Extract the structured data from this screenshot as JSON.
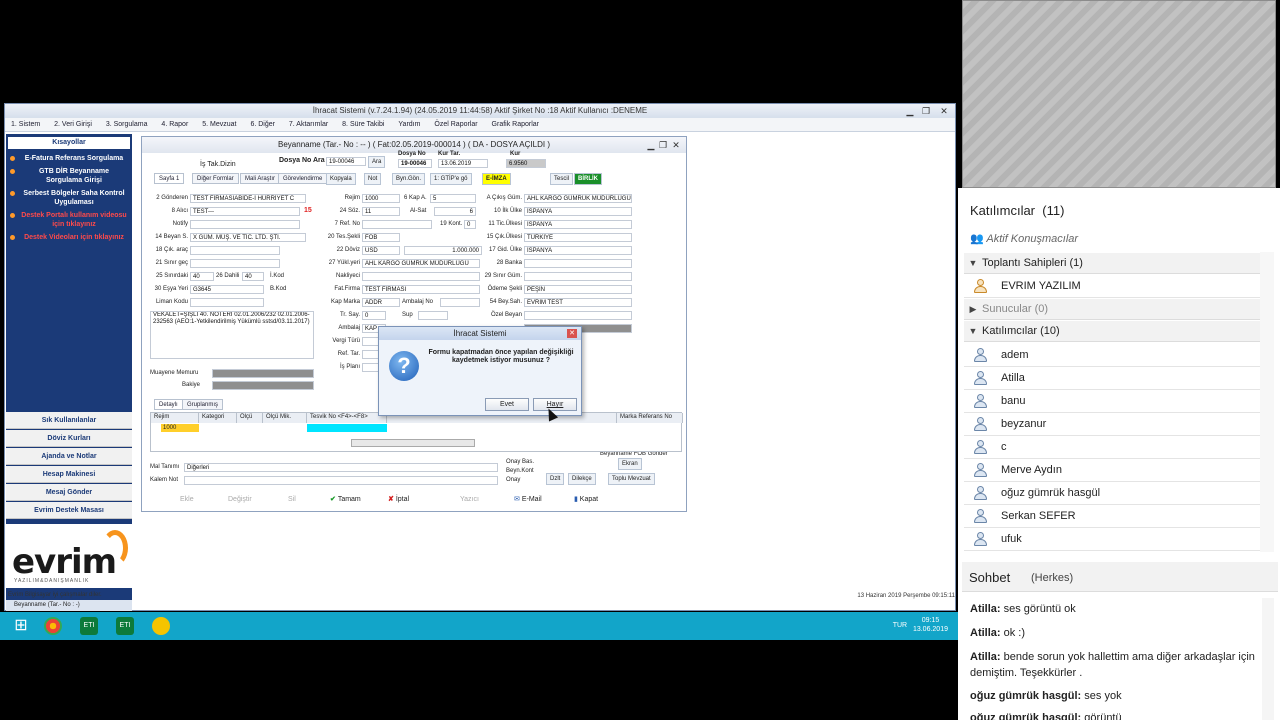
{
  "app": {
    "title": "İhracat Sistemi (v.7.24.1.94) (24.05.2019 11:44:58) Aktif Şirket No :18 Aktif Kullanıcı :DENEME",
    "menu": [
      "1. Sistem",
      "2. Veri Girişi",
      "3. Sorgulama",
      "4. Rapor",
      "5. Mevzuat",
      "6. Diğer",
      "7. Aktarımlar",
      "8. Süre Takibi",
      "Yardım",
      "Özel Raporlar",
      "Grafik Raporlar"
    ]
  },
  "sidebar": {
    "header": "Kısayollar",
    "items": [
      {
        "label": "E-Fatura Referans Sorgulama",
        "red": false
      },
      {
        "label": "GTB DİR Beyanname Sorgulama Girişi",
        "red": false
      },
      {
        "label": "Serbest Bölgeler Saha Kontrol Uygulaması",
        "red": false
      },
      {
        "label": "Destek Portalı kullanım videosu için tıklayınız",
        "red": true
      },
      {
        "label": "Destek Videoları için tıklayınız",
        "red": true
      }
    ],
    "bottom": [
      "Sık Kullanılanlar",
      "Döviz Kurları",
      "Ajanda ve Notlar",
      "Hesap Makinesi",
      "Mesaj Gönder",
      "Evrim Destek Masası"
    ],
    "logo_text": "evrim",
    "logo_sub": "YAZILIM&DANIŞMANLIK",
    "status": "Evrim Bilgisayar iyi çalışmalar diler.",
    "task": "Beyanname (Tar.- No : -)"
  },
  "form": {
    "title": "Beyanname (Tar.- No : -- ) ( Fat:02.05.2019-000014 ) ( DA - DOSYA AÇILDI )",
    "top": {
      "is_takip": "İş Tak.Dizin",
      "dosya_no_ara": "Dosya No Ara",
      "dosya_no_ara_val": "19-00046",
      "ara": "Ara",
      "dosya_no": "Dosya No",
      "dosya_no_val": "19-00046",
      "kur_tar": "Kur Tar.",
      "kur_tar_val": "13.06.2019",
      "kur": "Kur",
      "kur_val": "6.9560"
    },
    "tabs": [
      "Sayfa 1",
      "Diğer Formlar",
      "Mali Araştır",
      "Görevlendirme",
      "Kopyala",
      "Not",
      "Byn.Gön.",
      "1: GTİP'e gö",
      "E-İMZA",
      "Tescil",
      "BİRLİK"
    ],
    "left_fields": [
      {
        "label": "2 Gönderen",
        "value": "TEST FİRMASIABİDE-İ HÜRRİYET C"
      },
      {
        "label": "8 Alıcı",
        "value": "TEST---"
      },
      {
        "label": "Notify",
        "value": ""
      },
      {
        "label": "14 Beyan S.",
        "value": "X GÜM. MÜŞ. VE TİC. LTD. ŞTİ."
      },
      {
        "label": "18 Çık. araç",
        "value": ""
      },
      {
        "label": "21 Sınır geç",
        "value": ""
      },
      {
        "label": "25 Sınırdaki",
        "value": "40"
      },
      {
        "label": "30 Eşya Yeri",
        "value": "G3645"
      },
      {
        "label": "Liman Kodu",
        "value": ""
      }
    ],
    "left_extra": {
      "dahil_label": "26 Dahili",
      "dahil_val": "40",
      "ikod": "İ.Kod",
      "bkod": "B.Kod",
      "gond_red": "15"
    },
    "vekalet": "VEKALET=ŞİŞLİ 40. NOTERİ 02.01.2006/232 02.01.2006-232563 (AEO:1-Yetkilendirilmiş Yükümlü sstsd/03.11.2017)",
    "muayene": "Muayene Memuru",
    "bakiye": "Bakiye",
    "mid_fields": [
      {
        "label": "Rejim",
        "value": "1000"
      },
      {
        "label": "24 Söz.",
        "value": "11"
      },
      {
        "label": "7 Ref. No",
        "value": ""
      },
      {
        "label": "20 Tes.Şekli",
        "value": "FOB"
      },
      {
        "label": "22 Döviz",
        "value": "USD"
      },
      {
        "label": "27 Yükl.yeri",
        "value": "AHL KARGO GÜMRÜK MÜDÜRLÜĞÜ"
      },
      {
        "label": "Nakliyeci",
        "value": ""
      },
      {
        "label": "Fat.Firma",
        "value": "TEST FİRMASI"
      },
      {
        "label": "Kap Marka",
        "value": "ADDR"
      },
      {
        "label": "Tr. Say.",
        "value": "0"
      },
      {
        "label": "Ambalaj",
        "value": "KAP"
      },
      {
        "label": "Vergi Türü",
        "value": ""
      },
      {
        "label": "Ref. Tar.",
        "value": ""
      },
      {
        "label": "İş Planı",
        "value": ""
      }
    ],
    "mid_extra": {
      "kap_a": "6 Kap A.",
      "kap_a_val": "5",
      "al_sat": "Al-Sat",
      "al_sat_val": "6",
      "kont": "19 Kont.",
      "kont_val": "0",
      "tutar": "1.000.000",
      "ambalaj_no": "Ambalaj No",
      "sup": "Sup"
    },
    "right_fields": [
      {
        "label": "A Çıkış Güm.",
        "value": "AHL KARGO GÜMRÜK MÜDÜRLÜĞÜ"
      },
      {
        "label": "10 İlk Ülke",
        "value": "İSPANYA"
      },
      {
        "label": "11 Tic.Ülkesi",
        "value": "İSPANYA"
      },
      {
        "label": "15 Çık.Ülkesi",
        "value": "TÜRKİYE"
      },
      {
        "label": "17 Gid. Ülke",
        "value": "İSPANYA"
      },
      {
        "label": "28 Banka",
        "value": ""
      },
      {
        "label": "29 Sınır Güm.",
        "value": ""
      },
      {
        "label": "Ödeme Şekli",
        "value": "PEŞİN"
      },
      {
        "label": "54 Bey.Sah.",
        "value": "EVRİM TEST"
      },
      {
        "label": "Özel Beyan",
        "value": ""
      }
    ],
    "fob_check": "Beyanname FOB Gönder",
    "detail_tabs": [
      "Detaylı",
      "Gruplanmış"
    ],
    "grid_cols": [
      "Rejim",
      "Kategori",
      "Ölçü",
      "Ölçü Mik.",
      "Tesvik No <F4>-<F8>",
      "",
      "Marka Referans No"
    ],
    "grid_row": [
      "1000"
    ],
    "mal_tanimi": "Mal Tanımı",
    "mal_tanimi_val": "Diğerleri",
    "kalem_not": "Kalem Not",
    "onay": [
      "Onay Bas.",
      "Beyn.Kont",
      "Onay"
    ],
    "side_btns": [
      "Ekran",
      "Dzlt",
      "Dilekçe",
      "Toplu Mevzuat"
    ],
    "buttons": [
      {
        "label": "Ekle",
        "disabled": true
      },
      {
        "label": "Değiştir",
        "disabled": true
      },
      {
        "label": "Sil",
        "disabled": true
      },
      {
        "label": "Tamam",
        "disabled": false
      },
      {
        "label": "İptal",
        "disabled": false
      },
      {
        "label": "Yazıcı",
        "disabled": true
      },
      {
        "label": "E-Mail",
        "disabled": false
      },
      {
        "label": "Kapat",
        "disabled": false
      }
    ]
  },
  "dialog": {
    "title": "İhracat Sistemi",
    "message": "Formu kapatmadan önce yapılan değişikliği kaydetmek istiyor musunuz ?",
    "yes": "Evet",
    "no": "Hayır"
  },
  "app_status": "13 Haziran 2019 Perşembe 09:15:11",
  "taskbar": {
    "lang": "TUR",
    "time": "09:15",
    "date": "13.06.2019"
  },
  "panel": {
    "participants_title": "Katılımcılar",
    "participants_count": "(11)",
    "active_label": "Aktif Konuşmacılar",
    "hosts": {
      "label": "Toplantı Sahipleri (1)",
      "members": [
        "EVRIM YAZILIM"
      ]
    },
    "presenters": {
      "label": "Sunucular (0)"
    },
    "attendees": {
      "label": "Katılımcılar (10)",
      "members": [
        "adem",
        "Atilla",
        "banu",
        "beyzanur",
        "c",
        "Merve Aydın",
        "oğuz gümrük hasgül",
        "Serkan SEFER",
        "ufuk"
      ]
    }
  },
  "chat": {
    "title": "Sohbet",
    "scope": "(Herkes)",
    "messages": [
      {
        "author": "Atilla:",
        "text": "ses görüntü ok"
      },
      {
        "author": "Atilla:",
        "text": "ok :)"
      },
      {
        "author": "Atilla:",
        "text": "bende sorun yok hallettim ama diğer arkadaşlar için demiştim. Teşekkürler ."
      },
      {
        "author": "oğuz gümrük hasgül:",
        "text": "ses yok"
      },
      {
        "author": "oğuz gümrük hasgül:",
        "text": "görüntü"
      }
    ]
  }
}
